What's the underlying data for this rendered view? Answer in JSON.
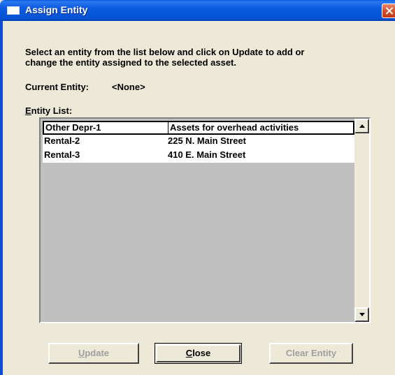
{
  "window": {
    "title": "Assign Entity"
  },
  "instructions": {
    "line1": "Select an entity from the list below and click on Update to add or",
    "line2": "change the entity assigned to the selected asset."
  },
  "current_entity": {
    "label": "Current Entity:",
    "value": "<None>"
  },
  "entity_list": {
    "label_accel": "E",
    "label_rest": "ntity List:",
    "rows": [
      {
        "name": "Other Depr-1",
        "description": "Assets for overhead activities",
        "selected": true
      },
      {
        "name": "Rental-2",
        "description": "225 N. Main Street",
        "selected": false
      },
      {
        "name": "Rental-3",
        "description": "410 E. Main Street",
        "selected": false
      }
    ]
  },
  "buttons": {
    "update_accel": "U",
    "update_rest": "pdate",
    "close_accel": "C",
    "close_rest": "lose",
    "clear": "Clear Entity"
  },
  "colors": {
    "titlebar": "#0553d4",
    "dialog_bg": "#ece9d8",
    "list_bg": "#c0c0c0",
    "disabled_text": "#a0a0a0"
  }
}
